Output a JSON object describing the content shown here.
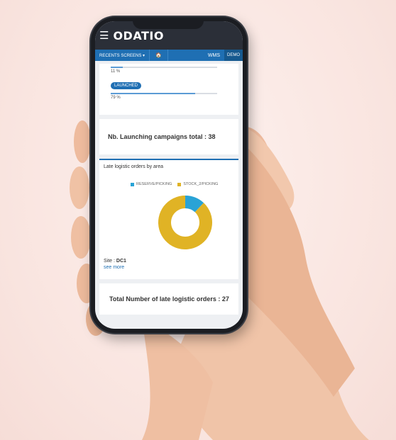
{
  "app": {
    "brand": "ODATIO"
  },
  "nav": {
    "recent": "RECENTS SCREENS ▾",
    "home": "🏠",
    "wms": "WMS",
    "demo": "DEMO"
  },
  "progress": [
    {
      "percent_label": "11 %",
      "value": 0.11
    },
    {
      "badge": "LAUNCHED",
      "percent_label": "79 %",
      "value": 0.79
    }
  ],
  "launch_total": "Nb. Launching campaigns total : 38",
  "late_orders": {
    "title": "Late logistic orders by area",
    "legend": [
      "RESERVE/PICKING",
      "STOCK_2/PICKING"
    ],
    "site_label": "Site : ",
    "site_value": "DC1",
    "see_more": "see more"
  },
  "late_total": "Total Number of late logistic orders : 27",
  "colors": {
    "reserve": "#29a3d6",
    "stock": "#e0b325",
    "accent": "#1f6fb3"
  },
  "chart_data": {
    "type": "pie",
    "categories": [
      "RESERVE/PICKING",
      "STOCK_2/PICKING"
    ],
    "values": [
      12,
      88
    ],
    "title": "Late logistic orders by area"
  }
}
